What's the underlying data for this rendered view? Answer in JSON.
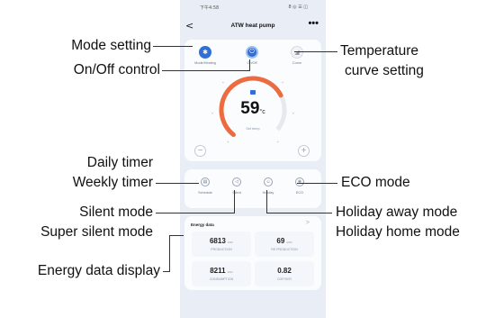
{
  "phone": {
    "status_time": "下午4:58",
    "status_right": "8 ◎ ☰ ◫",
    "back_glyph": "<",
    "title": "ATW heat pump",
    "more_glyph": "•••",
    "controls": [
      {
        "caption": "Mode/Heating",
        "icon": "mode-icon",
        "glyph": "✱"
      },
      {
        "caption": "On/Off",
        "icon": "power-icon",
        "glyph": "⏻"
      },
      {
        "caption": "Curve",
        "icon": "curve-icon",
        "glyph": "◢"
      }
    ],
    "temperature": {
      "value": "59",
      "unit": "°c",
      "caption": "Set temp",
      "arc_fraction": 0.72
    },
    "minus": "−",
    "plus": "+",
    "functions": [
      {
        "caption": "Schedule",
        "icon": "schedule-icon",
        "glyph": "▤"
      },
      {
        "caption": "Silent",
        "icon": "silent-icon",
        "glyph": "◁"
      },
      {
        "caption": "Holiday",
        "icon": "holiday-icon",
        "glyph": "☺"
      },
      {
        "caption": "ECO",
        "icon": "eco-icon",
        "glyph": "❀"
      }
    ],
    "energy": {
      "title": "Energy data",
      "chevron": ">",
      "items": [
        {
          "value": "6813",
          "unit": "kWh",
          "label": "PRODUCTION"
        },
        {
          "value": "69",
          "unit": "kWh",
          "label": "RE PRODUCTION"
        },
        {
          "value": "8211",
          "unit": "kWh",
          "label": "CONSUMPTION"
        },
        {
          "value": "0.82",
          "unit": "",
          "label": "COP/SCR"
        }
      ]
    }
  },
  "callouts": {
    "mode_setting": "Mode setting",
    "onoff_control": "On/Off control",
    "temp_curve_line1": "Temperature",
    "temp_curve_line2": "curve setting",
    "daily_timer": "Daily timer",
    "weekly_timer": "Weekly timer",
    "silent_mode": "Silent mode",
    "super_silent_mode": "Super silent mode",
    "energy_display": "Energy data display",
    "eco_mode": "ECO mode",
    "holiday_away": "Holiday away mode",
    "holiday_home": "Holiday home mode"
  },
  "colors": {
    "accent": "#2f6fd6",
    "arc": "#ec6b3f",
    "screen_bg": "#e9eef6"
  }
}
